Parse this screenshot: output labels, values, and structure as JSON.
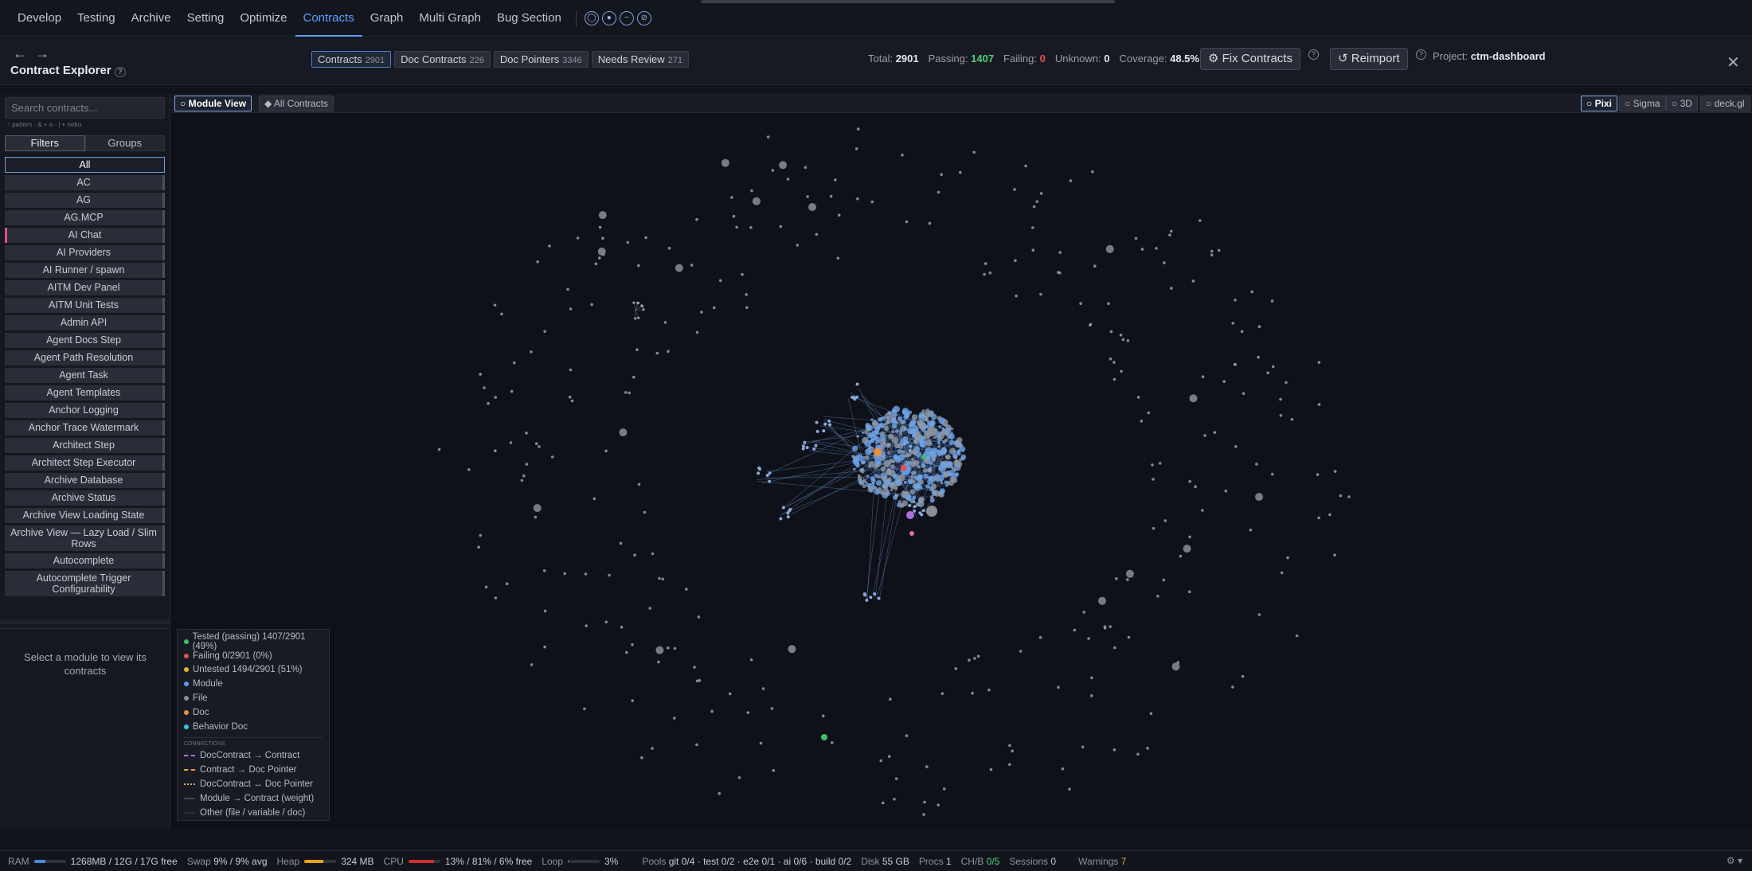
{
  "nav": {
    "items": [
      "Develop",
      "Testing",
      "Archive",
      "Setting",
      "Optimize",
      "Contracts",
      "Graph",
      "Multi Graph",
      "Bug Section"
    ],
    "active": "Contracts",
    "icons": [
      "circle-icon",
      "disc-icon",
      "wave-icon",
      "link-icon"
    ]
  },
  "header": {
    "back_arrow": "←",
    "forward_arrow": "→",
    "title": "Contract Explorer",
    "tabs": [
      {
        "label": "Contracts",
        "count": "2901"
      },
      {
        "label": "Doc Contracts",
        "count": "226"
      },
      {
        "label": "Doc Pointers",
        "count": "3346"
      },
      {
        "label": "Needs Review",
        "count": "271"
      }
    ],
    "stats": {
      "total_label": "Total:",
      "total": "2901",
      "passing_label": "Passing:",
      "passing": "1407",
      "failing_label": "Failing:",
      "failing": "0",
      "unknown_label": "Unknown:",
      "unknown": "0",
      "coverage_label": "Coverage:",
      "coverage": "48.5%"
    },
    "fix_button": "⚙ Fix Contracts",
    "reimport_button": "↺ Reimport",
    "project_label": "Project:",
    "project": "ctm-dashboard",
    "close": "✕"
  },
  "sidebar": {
    "search_placeholder": "Search contracts...",
    "search_hint": "↑ pattern · & + a · | + nebo",
    "tabs": [
      "Filters",
      "Groups"
    ],
    "modules": [
      "All",
      "AC",
      "AG",
      "AG.MCP",
      "AI Chat",
      "AI Providers",
      "AI Runner / spawn",
      "AITM Dev Panel",
      "AITM Unit Tests",
      "Admin API",
      "Agent Docs Step",
      "Agent Path Resolution",
      "Agent Task",
      "Agent Templates",
      "Anchor Logging",
      "Anchor Trace Watermark",
      "Architect Step",
      "Architect Step Executor",
      "Archive Database",
      "Archive Status",
      "Archive View Loading State",
      "Archive View — Lazy Load / Slim Rows",
      "Autocomplete",
      "Autocomplete Trigger Configurability"
    ],
    "empty_text": "Select a module to view its contracts"
  },
  "graph": {
    "view_buttons": [
      "Module View",
      "All Contracts"
    ],
    "renderers": [
      "Pixi",
      "Sigma",
      "3D",
      "deck.gl"
    ],
    "active_renderer": "Pixi",
    "legend": {
      "items": [
        {
          "label": "Tested (passing) 1407/2901 (49%)",
          "color": "#3cc06a"
        },
        {
          "label": "Failing 0/2901 (0%)",
          "color": "#e55050"
        },
        {
          "label": "Untested 1494/2901 (51%)",
          "color": "#e8b030"
        },
        {
          "label": "Module",
          "color": "#5a9cf0"
        },
        {
          "label": "File",
          "color": "#8a8e98"
        },
        {
          "label": "Doc",
          "color": "#e89040"
        },
        {
          "label": "Behavior Doc",
          "color": "#30c8e0"
        }
      ],
      "connections_title": "CONNECTIONS",
      "connections": [
        {
          "label": "DocContract → Contract",
          "color": "#b070e0"
        },
        {
          "label": "Contract → Doc Pointer",
          "color": "#e8a040"
        },
        {
          "label": "DocContract ↔ Doc Pointer",
          "color": "#d0b060"
        },
        {
          "label": "Module → Contract (weight)",
          "color": "#3a4a5a"
        },
        {
          "label": "Other (file / variable / doc)",
          "color": "#2e3038"
        }
      ]
    }
  },
  "statusbar": {
    "ram_label": "RAM",
    "ram": "1268MB / 12G / 17G free",
    "swap_label": "Swap",
    "swap": "9% / 9% avg",
    "heap_label": "Heap",
    "heap": "324 MB",
    "cpu_label": "CPU",
    "cpu": "13% / 81% / 6% free",
    "loop_label": "Loop",
    "loop": "3%",
    "pools_label": "Pools",
    "pools": "git 0/4 · test 0/2 · e2e 0/1 · ai 0/6 · build 0/2",
    "disk_label": "Disk",
    "disk": "55 GB",
    "procs_label": "Procs",
    "procs": "1",
    "chb_label": "CH/B",
    "chb": "0/5",
    "sessions_label": "Sessions",
    "sessions": "0",
    "warnings_label": "Warnings",
    "warnings": "7"
  }
}
